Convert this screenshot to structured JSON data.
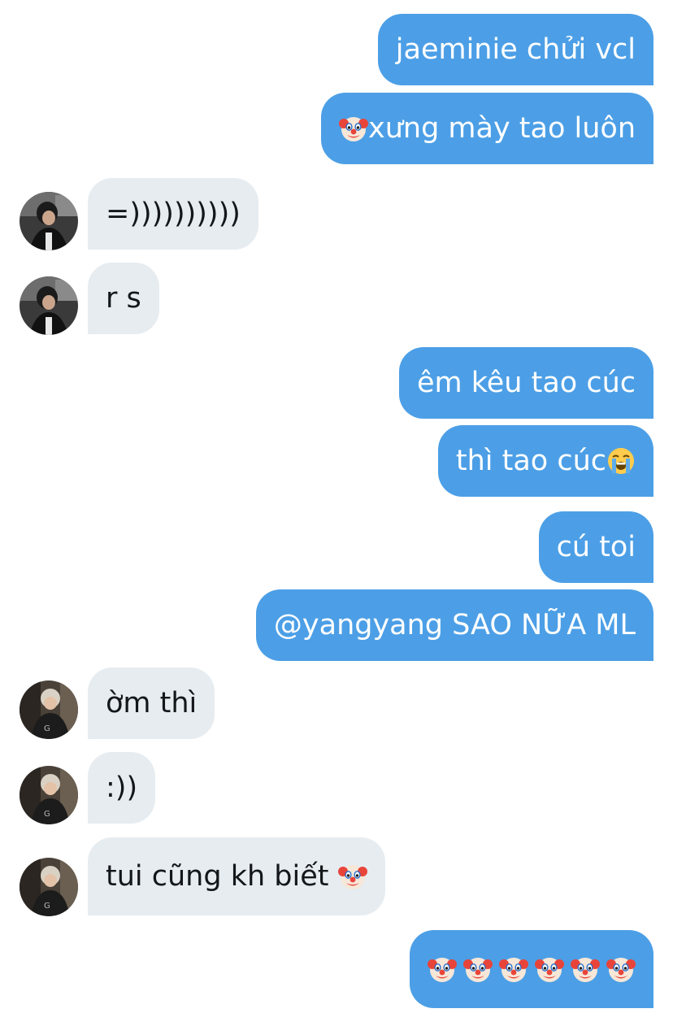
{
  "messages": [
    {
      "side": "out",
      "text": "jaeminie chửi vcl"
    },
    {
      "side": "out",
      "emoji_before": "clown-face",
      "text": "xưng mày tao luôn"
    },
    {
      "side": "in",
      "avatar": "avatar-dark-hair",
      "text": "=))))))))))"
    },
    {
      "side": "in",
      "avatar": "avatar-dark-hair",
      "text": "r s"
    },
    {
      "side": "out",
      "text": "êm kêu tao cúc"
    },
    {
      "side": "out",
      "text": "thì tao cúc",
      "emoji_after": "loudly-crying-face"
    },
    {
      "side": "out",
      "text": "cú toi"
    },
    {
      "side": "out",
      "text": "@yangyang SAO NỮA ML"
    },
    {
      "side": "in",
      "avatar": "avatar-light-hair",
      "text": "ờm thì"
    },
    {
      "side": "in",
      "avatar": "avatar-light-hair",
      "text": ":))"
    },
    {
      "side": "in",
      "avatar": "avatar-light-hair",
      "text": "tui cũng kh biết ",
      "emoji_after": "clown-face"
    },
    {
      "side": "out",
      "text": "",
      "emojis": [
        "clown-face",
        "clown-face",
        "clown-face",
        "clown-face",
        "clown-face",
        "clown-face"
      ]
    }
  ],
  "colors": {
    "outgoing_bubble": "#4c9fe6",
    "incoming_bubble": "#e6ecf0",
    "outgoing_text": "#ffffff",
    "incoming_text": "#14171a"
  }
}
